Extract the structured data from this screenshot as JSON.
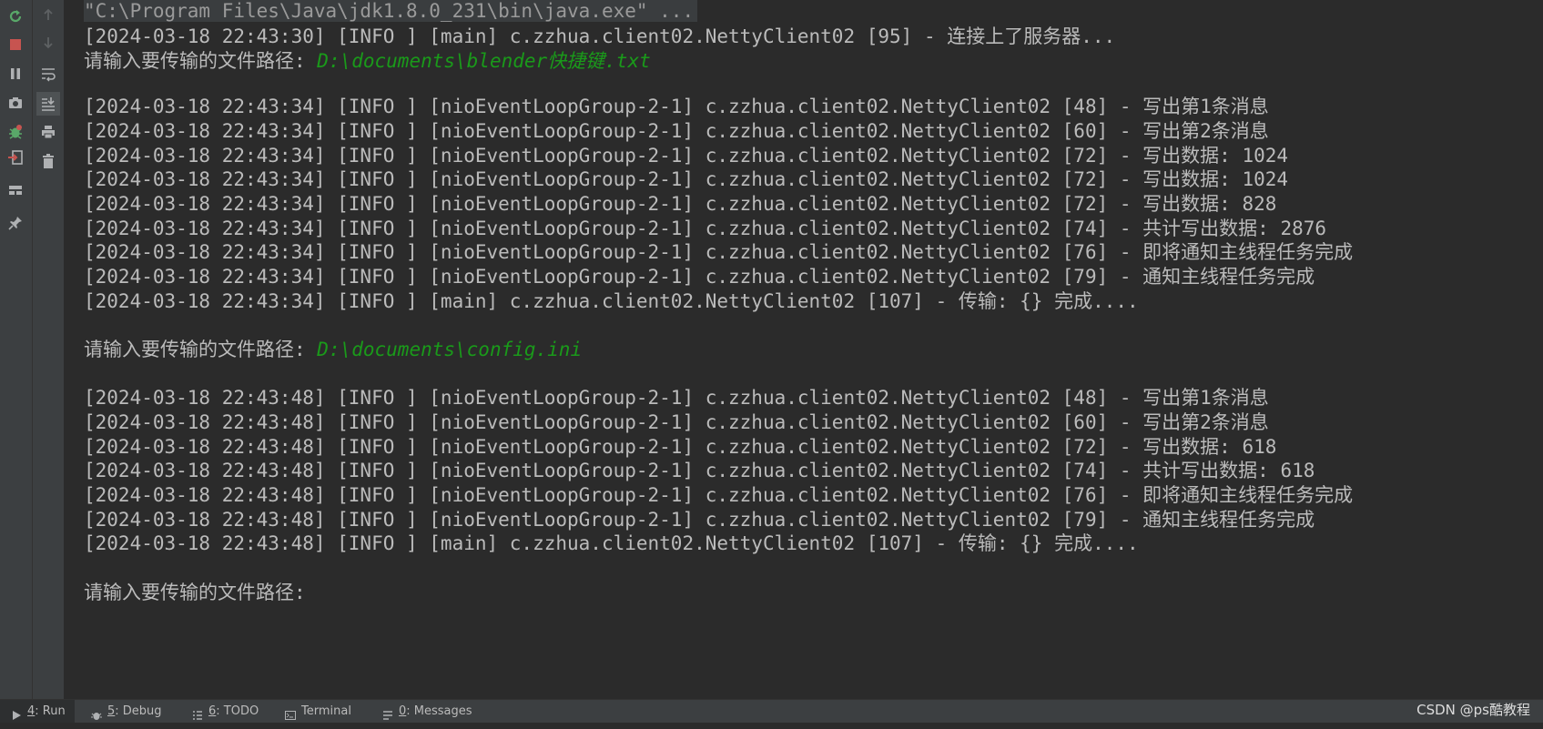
{
  "console": {
    "command_line": "\"C:\\Program Files\\Java\\jdk1.8.0_231\\bin\\java.exe\" ...",
    "lines": [
      "[2024-03-18 22:43:30] [INFO ] [main] c.zzhua.client02.NettyClient02 [95] - 连接上了服务器...",
      "请输入要传输的文件路径: ",
      "",
      "[2024-03-18 22:43:34] [INFO ] [nioEventLoopGroup-2-1] c.zzhua.client02.NettyClient02 [48] - 写出第1条消息",
      "[2024-03-18 22:43:34] [INFO ] [nioEventLoopGroup-2-1] c.zzhua.client02.NettyClient02 [60] - 写出第2条消息",
      "[2024-03-18 22:43:34] [INFO ] [nioEventLoopGroup-2-1] c.zzhua.client02.NettyClient02 [72] - 写出数据: 1024",
      "[2024-03-18 22:43:34] [INFO ] [nioEventLoopGroup-2-1] c.zzhua.client02.NettyClient02 [72] - 写出数据: 1024",
      "[2024-03-18 22:43:34] [INFO ] [nioEventLoopGroup-2-1] c.zzhua.client02.NettyClient02 [72] - 写出数据: 828",
      "[2024-03-18 22:43:34] [INFO ] [nioEventLoopGroup-2-1] c.zzhua.client02.NettyClient02 [74] - 共计写出数据: 2876",
      "[2024-03-18 22:43:34] [INFO ] [nioEventLoopGroup-2-1] c.zzhua.client02.NettyClient02 [76] - 即将通知主线程任务完成",
      "[2024-03-18 22:43:34] [INFO ] [nioEventLoopGroup-2-1] c.zzhua.client02.NettyClient02 [79] - 通知主线程任务完成",
      "[2024-03-18 22:43:34] [INFO ] [main] c.zzhua.client02.NettyClient02 [107] - 传输: {} 完成....",
      "",
      "请输入要传输的文件路径: ",
      "",
      "[2024-03-18 22:43:48] [INFO ] [nioEventLoopGroup-2-1] c.zzhua.client02.NettyClient02 [48] - 写出第1条消息",
      "[2024-03-18 22:43:48] [INFO ] [nioEventLoopGroup-2-1] c.zzhua.client02.NettyClient02 [60] - 写出第2条消息",
      "[2024-03-18 22:43:48] [INFO ] [nioEventLoopGroup-2-1] c.zzhua.client02.NettyClient02 [72] - 写出数据: 618",
      "[2024-03-18 22:43:48] [INFO ] [nioEventLoopGroup-2-1] c.zzhua.client02.NettyClient02 [74] - 共计写出数据: 618",
      "[2024-03-18 22:43:48] [INFO ] [nioEventLoopGroup-2-1] c.zzhua.client02.NettyClient02 [76] - 即将通知主线程任务完成",
      "[2024-03-18 22:43:48] [INFO ] [nioEventLoopGroup-2-1] c.zzhua.client02.NettyClient02 [79] - 通知主线程任务完成",
      "[2024-03-18 22:43:48] [INFO ] [main] c.zzhua.client02.NettyClient02 [107] - 传输: {} 完成....",
      "",
      "请输入要传输的文件路径: "
    ],
    "user_inputs": {
      "input1": "D:\\documents\\blender快捷键.txt",
      "input2": "D:\\documents\\config.ini"
    }
  },
  "toolbar": {
    "left_icons": [
      "rerun-icon",
      "stop-icon",
      "pause-icon",
      "camera-icon",
      "debug-bug-icon",
      "exit-icon",
      "layout-icon",
      "pin-icon"
    ],
    "second_icons": [
      "up-arrow-icon",
      "down-arrow-icon",
      "soft-wrap-icon",
      "scroll-to-end-icon",
      "print-icon",
      "trash-icon"
    ]
  },
  "bottom_tabs": [
    {
      "num": "4",
      "label": ": Run",
      "icon": "run-icon"
    },
    {
      "num": "5",
      "label": ": Debug",
      "icon": "bug-icon"
    },
    {
      "num": "6",
      "label": ": TODO",
      "icon": "list-icon"
    },
    {
      "num": "",
      "label": "Terminal",
      "icon": "terminal-icon"
    },
    {
      "num": "0",
      "label": ": Messages",
      "icon": "messages-icon"
    }
  ],
  "watermark": "CSDN @ps酷教程",
  "colors": {
    "background": "#2b2b2b",
    "text": "#bbbbbb",
    "input": "#1a9a1a",
    "panel": "#3c3f41"
  }
}
